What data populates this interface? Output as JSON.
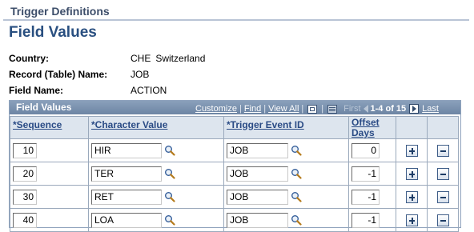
{
  "header": {
    "title": "Trigger Definitions"
  },
  "page_title": "Field Values",
  "info": {
    "country_label": "Country:",
    "country_code": "CHE",
    "country_name": "Switzerland",
    "record_label": "Record (Table) Name:",
    "record_value": "JOB",
    "field_label": "Field Name:",
    "field_value": "ACTION"
  },
  "grid": {
    "title": "Field Values",
    "nav": {
      "customize": "Customize",
      "find": "Find",
      "view_all": "View All",
      "first": "First",
      "range": "1-4 of 15",
      "last": "Last",
      "separator": "|"
    },
    "columns": {
      "sequence": "*Sequence",
      "character_value": "*Character Value",
      "trigger_event_id": "*Trigger Event ID",
      "offset_days_1": "Offset",
      "offset_days_2": "Days"
    },
    "rows": [
      {
        "sequence": "10",
        "character_value": "HIR",
        "trigger_event_id": "JOB",
        "offset_days": "0"
      },
      {
        "sequence": "20",
        "character_value": "TER",
        "trigger_event_id": "JOB",
        "offset_days": "-1"
      },
      {
        "sequence": "30",
        "character_value": "RET",
        "trigger_event_id": "JOB",
        "offset_days": "-1"
      },
      {
        "sequence": "40",
        "character_value": "LOA",
        "trigger_event_id": "JOB",
        "offset_days": "-1"
      }
    ]
  },
  "icons": {
    "lookup": "magnifier-icon",
    "add_row": "plus-icon",
    "delete_row": "minus-icon",
    "zoom": "zoom-grid-icon",
    "download": "download-grid-icon",
    "previous": "previous-arrow-icon",
    "next": "next-arrow-icon"
  },
  "colors": {
    "title_blue": "#294f80",
    "grid_header_bg": "#dde5ee",
    "grid_titlebar": "#7990ae",
    "link_blue": "#2a4b85"
  }
}
